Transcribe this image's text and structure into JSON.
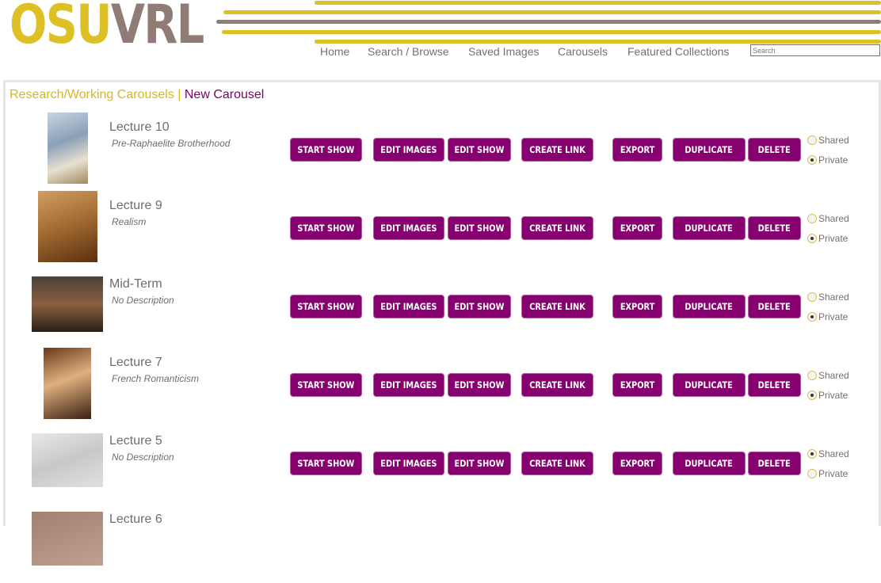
{
  "header": {
    "logo_a": "OSU",
    "logo_b": "VRL",
    "nav": [
      "Home",
      "Search / Browse",
      "Saved Images",
      "Carousels",
      "Featured Collections"
    ],
    "search_placeholder": "Search",
    "colors": {
      "gold": "#dcc026",
      "taupe": "#8f7c76",
      "purple": "#870070"
    }
  },
  "breadcrumb": {
    "parent": "Research/Working Carousels",
    "sep": "|",
    "current": "New Carousel"
  },
  "buttons": {
    "start": "START SHOW",
    "edit_images": "EDIT IMAGES",
    "edit_show": "EDIT SHOW",
    "create_link": "CREATE LINK",
    "export": "EXPORT",
    "duplicate": "DUPLICATE",
    "delete": "DELETE",
    "shared": "Shared",
    "private": "Private"
  },
  "carousels": [
    {
      "title": "Lecture 10",
      "desc": "Pre-Raphaelite Brotherhood",
      "visibility": "private"
    },
    {
      "title": "Lecture 9",
      "desc": "Realism",
      "visibility": "private"
    },
    {
      "title": "Mid-Term",
      "desc": "No Description",
      "visibility": "private"
    },
    {
      "title": "Lecture 7",
      "desc": "French Romanticism",
      "visibility": "private"
    },
    {
      "title": "Lecture 5",
      "desc": "No Description",
      "visibility": "shared"
    },
    {
      "title": "Lecture 6",
      "desc": "",
      "visibility": ""
    }
  ]
}
